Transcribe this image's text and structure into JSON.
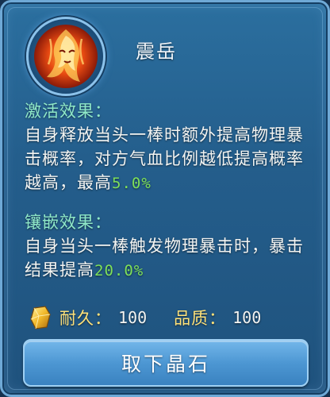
{
  "item": {
    "name": "震岳",
    "icon": "flame-spirit-icon"
  },
  "activation": {
    "heading": "激活效果：",
    "text": "自身释放当头一棒时额外提高物理暴击概率，对方气血比例越低提高概率越高，最高",
    "value": "5.0%"
  },
  "inlay": {
    "heading": "镶嵌效果：",
    "text": "自身当头一棒触发物理暴击时，暴击结果提高",
    "value": "20.0%"
  },
  "stats": {
    "icon": "gold-crystal-icon",
    "durability_label": "耐久：",
    "durability_value": "100",
    "quality_label": "品质：",
    "quality_value": "100"
  },
  "action": {
    "label": "取下晶石"
  },
  "colors": {
    "heading": "#8fe8c8",
    "highlight": "#7ee05a",
    "stat_label": "#ffe27a",
    "button": "#4d97d3"
  }
}
